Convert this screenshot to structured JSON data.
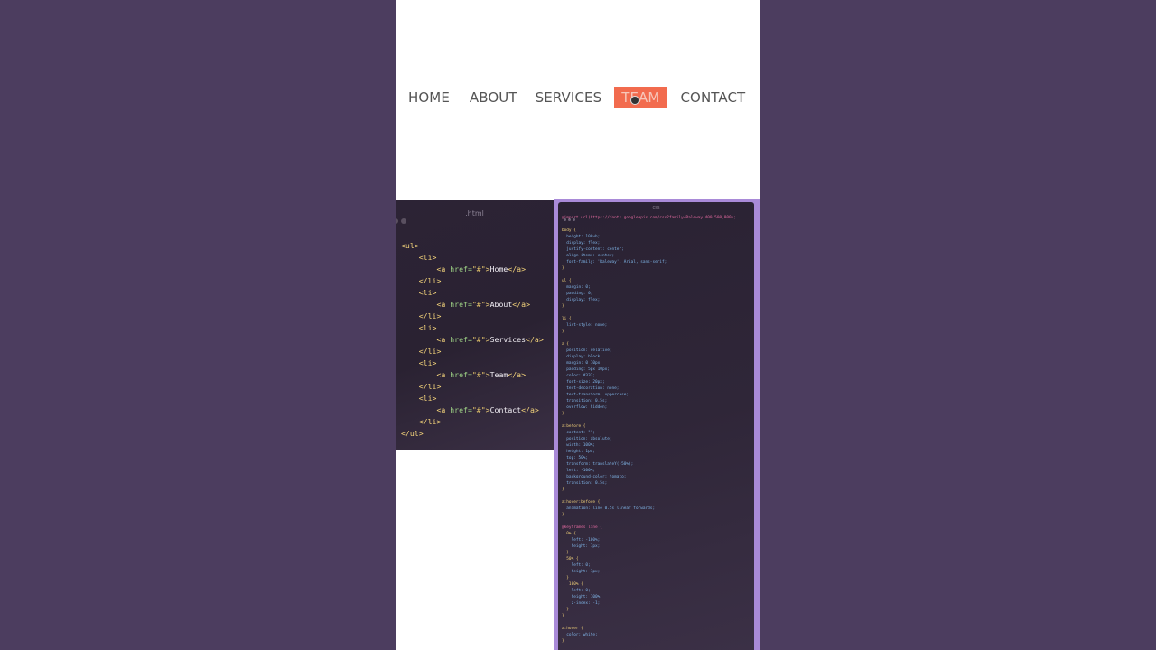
{
  "preview": {
    "nav": [
      "Home",
      "About",
      "Services",
      "Team",
      "Contact"
    ],
    "active_index": 3,
    "accent_color": "#f26b4e"
  },
  "html_editor": {
    "title": ".html",
    "lines": [
      "<ul>",
      "    <li>",
      "        <a href=\"#\">Home</a>",
      "    </li>",
      "    <li>",
      "        <a href=\"#\">About</a>",
      "    </li>",
      "    <li>",
      "        <a href=\"#\">Services</a>",
      "    </li>",
      "    <li>",
      "        <a href=\"#\">Team</a>",
      "    </li>",
      "    <li>",
      "        <a href=\"#\">Contact</a>",
      "    </li>",
      "</ul>"
    ]
  },
  "css_editor": {
    "title": "css",
    "lines": [
      "@import url(https://fonts.googleapis.com/css?family=Raleway:400,500,800);",
      "",
      "body {",
      "  height: 100vh;",
      "  display: flex;",
      "  justify-content: center;",
      "  align-items: center;",
      "  font-family: 'Raleway', Arial, sans-serif;",
      "}",
      "",
      "ul {",
      "  margin: 0;",
      "  padding: 0;",
      "  display: flex;",
      "}",
      "",
      "li {",
      "  list-style: none;",
      "}",
      "",
      "a {",
      "  position: relative;",
      "  display: block;",
      "  margin: 0 10px;",
      "  padding: 5px 10px;",
      "  color: #333;",
      "  font-size: 20px;",
      "  text-decoration: none;",
      "  text-transform: uppercase;",
      "  transition: 0.5s;",
      "  overflow: hidden;",
      "}",
      "",
      "a:before {",
      "  content: \"\";",
      "  position: absolute;",
      "  width: 100%;",
      "  height: 1px;",
      "  top: 50%;",
      "  transform: translateY(-50%);",
      "  left: -100%;",
      "  background-color: tomato;",
      "  transition: 0.5s;",
      "}",
      "",
      "a:hover:before {",
      "  animation: line 0.5s linear forwards;",
      "}",
      "",
      "@keyframes line {",
      "  0% {",
      "    left: -100%;",
      "    height: 1px;",
      "  }",
      "  50% {",
      "    left: 0;",
      "    height: 1px;",
      "  }",
      "   100% {",
      "    left: 0;",
      "    height: 100%;",
      "    z-index: -1;",
      "  }",
      "}",
      "",
      "a:hover {",
      "  color: white;",
      "}"
    ]
  }
}
